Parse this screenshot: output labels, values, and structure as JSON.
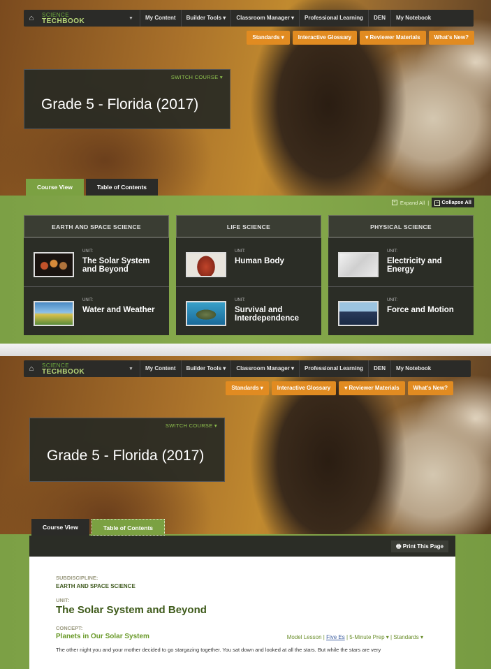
{
  "nav": {
    "logo_line1": "SCIENCE",
    "logo_line2": "TECHBOOK",
    "items": [
      "My Content",
      "Builder Tools ▾",
      "Classroom Manager ▾",
      "Professional Learning",
      "DEN",
      "My Notebook"
    ]
  },
  "subnav": [
    "Standards ▾",
    "Interactive Glossary",
    "▾ Reviewer Materials",
    "What's New?"
  ],
  "course": {
    "switch": "SWITCH COURSE ▾",
    "title": "Grade 5 - Florida (2017)"
  },
  "tabs": [
    "Course View",
    "Table of Contents"
  ],
  "expand": {
    "expand_label": "Expand All",
    "collapse_label": "Collapse All"
  },
  "disciplines": [
    {
      "name": "EARTH AND SPACE SCIENCE",
      "units": [
        {
          "label": "UNIT:",
          "name": "The Solar System and Beyond"
        },
        {
          "label": "UNIT:",
          "name": "Water and Weather"
        }
      ]
    },
    {
      "name": "LIFE SCIENCE",
      "units": [
        {
          "label": "UNIT:",
          "name": "Human Body"
        },
        {
          "label": "UNIT:",
          "name": "Survival and Interdependence"
        }
      ]
    },
    {
      "name": "PHYSICAL SCIENCE",
      "units": [
        {
          "label": "UNIT:",
          "name": "Electricity and Energy"
        },
        {
          "label": "UNIT:",
          "name": "Force and Motion"
        }
      ]
    }
  ],
  "toc": {
    "print": "Print This Page",
    "subdiscipline_label": "SUBDISCIPLINE:",
    "subdiscipline": "EARTH AND SPACE SCIENCE",
    "unit_label": "UNIT:",
    "unit": "The Solar System and Beyond",
    "concept_label": "CONCEPT:",
    "concept": "Planets in Our Solar System",
    "model_lesson": "Model Lesson",
    "five_es": "Five Es",
    "prep": "5-Minute Prep ▾",
    "standards": "Standards ▾",
    "paragraph": "The other night you and your mother decided to go stargazing together. You sat down and looked at all the stars. But while the stars are very"
  }
}
